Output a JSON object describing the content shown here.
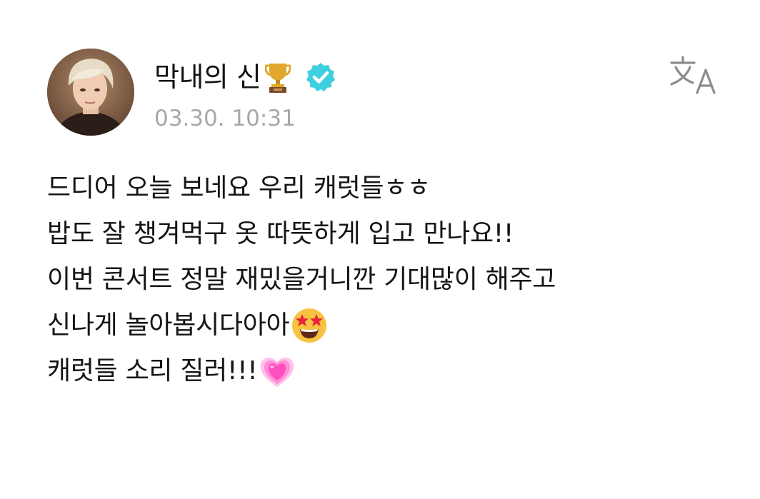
{
  "post": {
    "author": {
      "name": "막내의 신",
      "verified": true,
      "name_emoji": "trophy-icon",
      "avatar": "avatar-photo"
    },
    "timestamp": "03.30. 10:31",
    "translate_icon": "translate-icon",
    "body_lines": [
      {
        "text": "드디어 오늘 보네요 우리 캐럿들ㅎㅎ",
        "emoji": null
      },
      {
        "text": "밥도 잘 챙겨먹구 옷 따뜻하게 입고 만나요!!",
        "emoji": null
      },
      {
        "text": "이번 콘서트 정말 재밌을거니깐 기대많이 해주고",
        "emoji": null
      },
      {
        "text": "신나게 놀아봅시다아아",
        "emoji": "star-struck-emoji"
      },
      {
        "text": "캐럿들 소리 질러!!!",
        "emoji": "growing-heart-emoji"
      }
    ]
  },
  "colors": {
    "text": "#151515",
    "timestamp": "#a8a8a8",
    "verified_badge": "#3ecfe0",
    "translate_icon": "#8c8c8c"
  }
}
